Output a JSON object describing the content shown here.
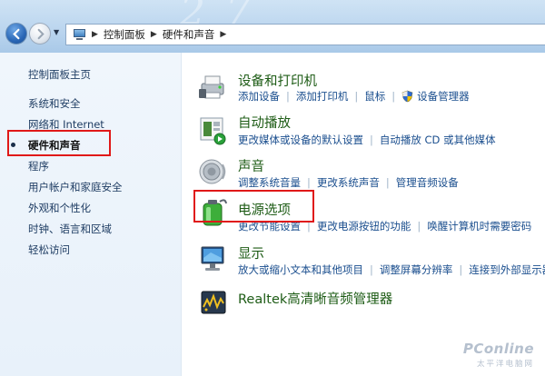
{
  "address": {
    "crumbs": [
      "控制面板",
      "硬件和声音"
    ]
  },
  "sidebar": {
    "items": [
      {
        "label": "控制面板主页"
      },
      {
        "label": "系统和安全"
      },
      {
        "label": "网络和 Internet"
      },
      {
        "label": "硬件和声音",
        "active": true
      },
      {
        "label": "程序"
      },
      {
        "label": "用户帐户和家庭安全"
      },
      {
        "label": "外观和个性化"
      },
      {
        "label": "时钟、语言和区域"
      },
      {
        "label": "轻松访问"
      }
    ]
  },
  "categories": [
    {
      "title": "设备和打印机",
      "icon": "printer-icon",
      "links": [
        "添加设备",
        "添加打印机",
        "鼠标",
        "设备管理器"
      ]
    },
    {
      "title": "自动播放",
      "icon": "autoplay-icon",
      "links": [
        "更改媒体或设备的默认设置",
        "自动播放 CD 或其他媒体"
      ]
    },
    {
      "title": "声音",
      "icon": "speaker-icon",
      "links": [
        "调整系统音量",
        "更改系统声音",
        "管理音频设备"
      ]
    },
    {
      "title": "电源选项",
      "icon": "battery-icon",
      "links": [
        "更改节能设置",
        "更改电源按钮的功能",
        "唤醒计算机时需要密码"
      ]
    },
    {
      "title": "显示",
      "icon": "monitor-icon",
      "links": [
        "放大或缩小文本和其他项目",
        "调整屏幕分辨率",
        "连接到外部显示器"
      ]
    },
    {
      "title": "Realtek高清晰音频管理器",
      "icon": "realtek-icon",
      "links": []
    }
  ],
  "watermark": {
    "line1": "PConline",
    "line2": "太平洋电脑网"
  },
  "colors": {
    "link": "#1a4e8e",
    "category": "#1e5c16",
    "highlight": "#e01818"
  }
}
